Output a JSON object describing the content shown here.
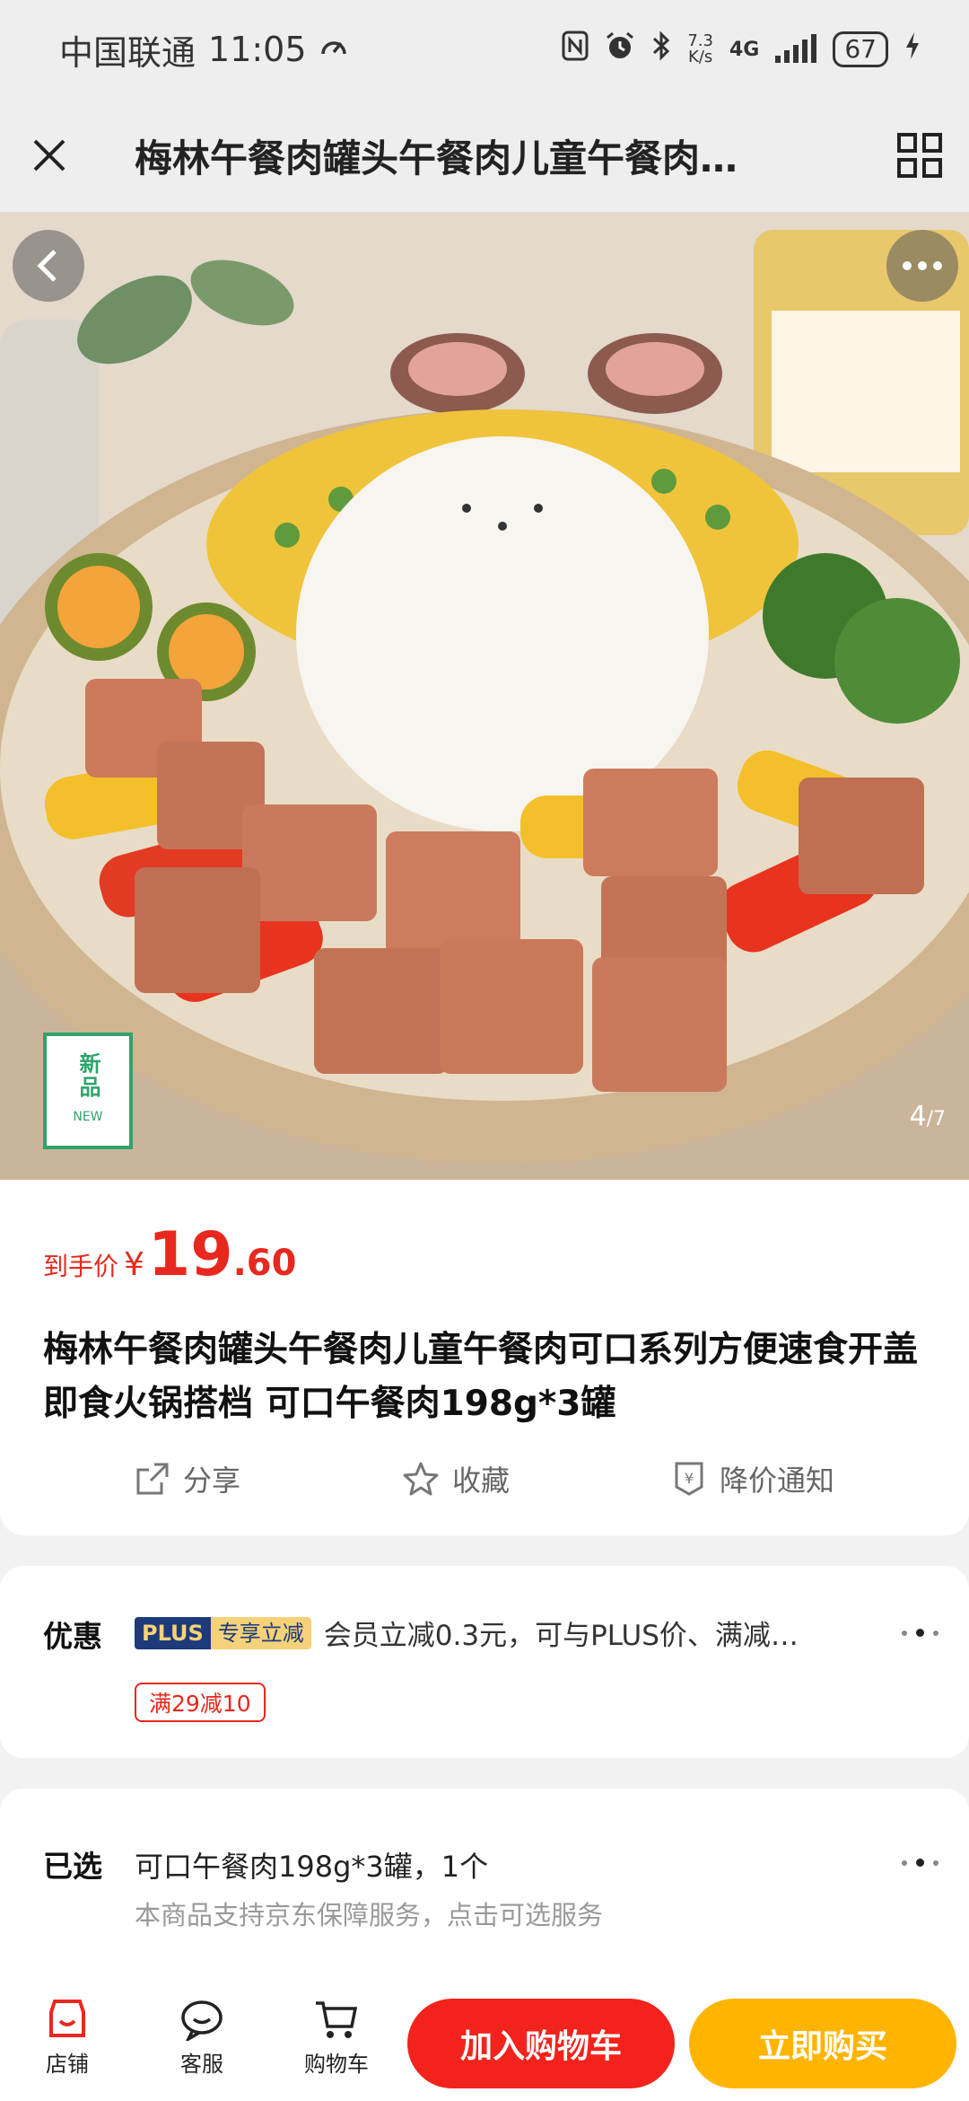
{
  "status_bar": {
    "carrier": "中国联通",
    "time": "11:05",
    "speed_value": "7.3",
    "speed_unit": "K/s",
    "network": "4G",
    "battery": "67"
  },
  "title_bar": {
    "title": "梅林午餐肉罐头午餐肉儿童午餐肉…"
  },
  "gallery": {
    "new_badge_cn": "新品",
    "new_badge_en": "NEW",
    "current": "4",
    "total": "/7"
  },
  "price": {
    "label": "到手价",
    "currency": "¥",
    "integer": "19",
    "decimal": ".60"
  },
  "product": {
    "title": "梅林午餐肉罐头午餐肉儿童午餐肉可口系列方便速食开盖即食火锅搭档 可口午餐肉198g*3罐"
  },
  "actions": [
    {
      "label": "分享",
      "icon": "share-icon"
    },
    {
      "label": "收藏",
      "icon": "star-icon"
    },
    {
      "label": "降价通知",
      "icon": "price-alert-icon"
    }
  ],
  "promo": {
    "label": "优惠",
    "plus_tag": "PLUS",
    "plus_tag_sub": "专享立减",
    "text": "会员立减0.3元，可与PLUS价、满减…",
    "coupon": "满29减10"
  },
  "selected": {
    "label": "已选",
    "value": "可口午餐肉198g*3罐，1个",
    "sub": "本商品支持京东保障服务，点击可选服务"
  },
  "bottom_bar": {
    "tabs": [
      {
        "label": "店铺",
        "icon": "shop-icon"
      },
      {
        "label": "客服",
        "icon": "service-icon"
      },
      {
        "label": "购物车",
        "icon": "cart-icon"
      }
    ],
    "add_cart": "加入购物车",
    "buy_now": "立即购买"
  },
  "colors": {
    "accent_red": "#e8281e",
    "buy_yellow": "#ffb400",
    "plus_navy": "#1d3a7a",
    "new_green": "#2ea46a"
  }
}
